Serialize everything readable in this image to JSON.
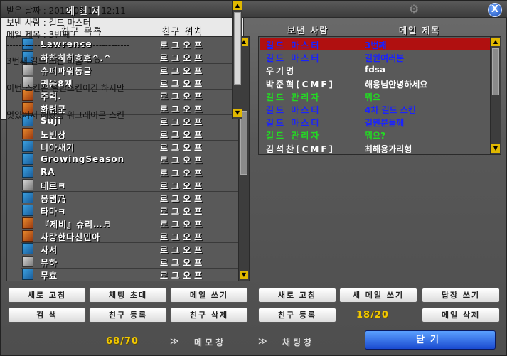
{
  "window": {
    "title": "메신저",
    "close_label": "X"
  },
  "headers": {
    "friend_list": "친구 목록",
    "friend_location": "친구 위치",
    "sender": "보낸 사람",
    "mail_subject": "메일 제목"
  },
  "friends": [
    {
      "name": "Lawrence",
      "location": "로그오프",
      "icon": "blue"
    },
    {
      "name": "하하히히호호^.^",
      "location": "로그오프",
      "icon": "blue"
    },
    {
      "name": "슈퍼파워동글",
      "location": "로그오프",
      "icon": "dog"
    },
    {
      "name": "귀옴8계",
      "location": "로그오프",
      "icon": "dog"
    },
    {
      "name": "주먹.",
      "location": "로그오프",
      "icon": "alt"
    },
    {
      "name": "화련군",
      "location": "로그오프",
      "icon": "alt"
    },
    {
      "name": "Suji",
      "location": "로그오프",
      "icon": "blue"
    },
    {
      "name": "  노빈상",
      "location": "로그오프",
      "icon": "alt"
    },
    {
      "name": "니아새기",
      "location": "로그오프",
      "icon": "blue"
    },
    {
      "name": "GrowingSeason",
      "location": "로그오프",
      "icon": "blue"
    },
    {
      "name": "RA",
      "location": "로그오프",
      "icon": "blue"
    },
    {
      "name": "테르ㅋ",
      "location": "로그오프",
      "icon": "dog"
    },
    {
      "name": "몽탬乃",
      "location": "로그오프",
      "icon": "blue"
    },
    {
      "name": "타마ㅋ",
      "location": "로그오프",
      "icon": "blue"
    },
    {
      "name": "『제비』슈리…♬",
      "location": "로그오프",
      "icon": "alt"
    },
    {
      "name": "사랑한다신민아",
      "location": "로그오프",
      "icon": "alt"
    },
    {
      "name": "사서",
      "location": "로그오프",
      "icon": "blue"
    },
    {
      "name": "뮤하",
      "location": "로그오프",
      "icon": "dog"
    },
    {
      "name": "무효",
      "location": "로그오프",
      "icon": "blue"
    }
  ],
  "mails": [
    {
      "sender": "길드 마스터",
      "subject": "3번째",
      "sender_color": "#1a22ff",
      "subject_color": "#1a22ff",
      "selected": true
    },
    {
      "sender": "길드 마스터",
      "subject": "길원여러분",
      "sender_color": "#1a22ff",
      "subject_color": "#1a22ff"
    },
    {
      "sender": "우기명",
      "subject": "fdsa",
      "sender_color": "#ffffff",
      "subject_color": "#ffffff"
    },
    {
      "sender": "  박준혁[CMF]",
      "subject": "해용님안녕하세요",
      "sender_color": "#ffffff",
      "subject_color": "#ffffff"
    },
    {
      "sender": "길드 관리자",
      "subject": "뭐요",
      "sender_color": "#22dd22",
      "subject_color": "#22dd22"
    },
    {
      "sender": "길드 마스터",
      "subject": "4차 길드 스킨",
      "sender_color": "#1a22ff",
      "subject_color": "#1a22ff"
    },
    {
      "sender": "길드 마스터",
      "subject": "길원분들께",
      "sender_color": "#1a22ff",
      "subject_color": "#1a22ff"
    },
    {
      "sender": "길드 관리자",
      "subject": "뭐요?",
      "sender_color": "#22dd22",
      "subject_color": "#22dd22"
    },
    {
      "sender": "  김석찬[CMF]",
      "subject": "최해용가리형",
      "sender_color": "#ffffff",
      "subject_color": "#ffffff"
    }
  ],
  "message": {
    "received_date": "받은 날짜 : 2012-05-12 12:11",
    "sender": "보낸 사람 : 길드 마스터",
    "subject": "메일 제목 : 3번째",
    "divider": "----------------------------------------",
    "body": [
      "3번째 길드 스킨 바꿈 ㅇㅇ",
      "",
      "이번 스킨은 널린스킨이긴 하지만",
      "",
      "멋있어서 해봤음 워그레이몬 스킨"
    ]
  },
  "buttons": {
    "refresh_left": "새로 고침",
    "chat_invite": "채팅 초대",
    "send_mail": "메일 쓰기",
    "search": "검   색",
    "add_friend": "친구 등록",
    "delete_friend": "친구 삭제",
    "refresh_right": "새로 고침",
    "new_mail": "새 메일 쓰기",
    "reply": "답장 쓰기",
    "add_friend_right": "친구 등록",
    "delete_mail": "메일 삭제",
    "close": "닫기"
  },
  "counters": {
    "friends": "68/70",
    "mail": "18/20"
  },
  "links": {
    "memo": "메모창",
    "chat": "채팅창",
    "arrow": "≫"
  },
  "colors": {
    "selected_row": "#b01010",
    "accent_yellow": "#f2c800",
    "close_button": "#1a4ad0"
  }
}
